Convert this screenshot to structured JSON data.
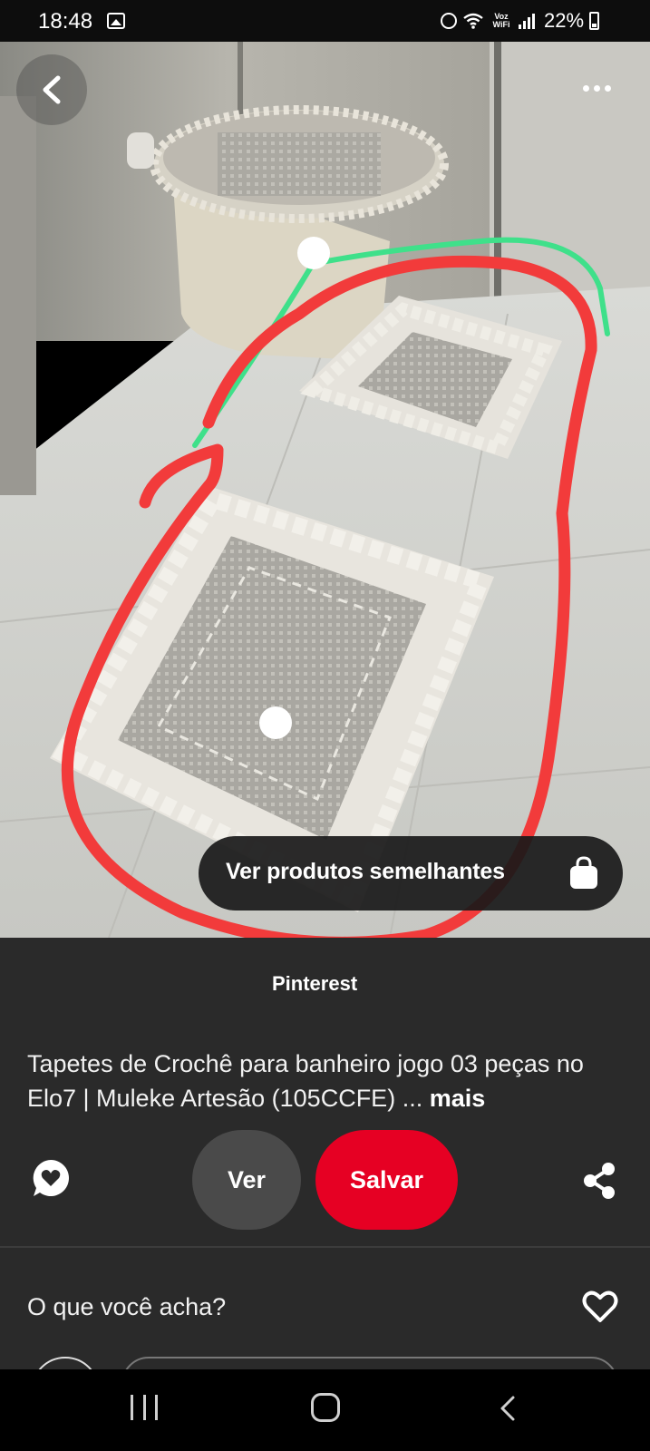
{
  "status_bar": {
    "time": "18:48",
    "network_label": "Voz WiFi",
    "battery": "22%",
    "icons": [
      "gallery-icon",
      "alarm-icon",
      "wifi-icon",
      "signal-icon",
      "battery-icon"
    ]
  },
  "top_actions": {
    "back_icon": "chevron-left-icon",
    "more_icon": "more-horizontal-icon"
  },
  "photo": {
    "subject": "crochet bathroom rug set",
    "annotation_colors": {
      "red": "#f23b3b",
      "green": "#3fe08a"
    }
  },
  "similar_products": {
    "label": "Ver produtos semelhantes",
    "icon": "shopping-bag-icon"
  },
  "pin": {
    "source": "Pinterest",
    "description": "Tapetes de Crochê para banheiro jogo 03 peças no Elo7 | Muleke Artesão (105CCFE) ...",
    "more_label": "mais"
  },
  "actions": {
    "comment_icon": "comment-heart-icon",
    "view_label": "Ver",
    "save_label": "Salvar",
    "share_icon": "share-icon",
    "save_color": "#e60023"
  },
  "feedback": {
    "question": "O que você acha?",
    "heart_icon": "heart-outline-icon"
  },
  "nav_bar": {
    "icons": [
      "recents-icon",
      "home-icon",
      "back-icon"
    ]
  }
}
